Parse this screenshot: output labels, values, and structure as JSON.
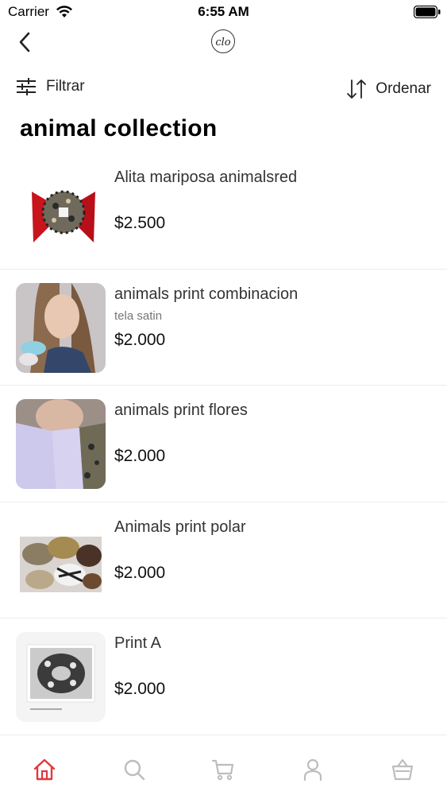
{
  "status_bar": {
    "carrier": "Carrier",
    "time": "6:55 AM"
  },
  "nav": {
    "logo_text": "clo"
  },
  "toolbar": {
    "filter_label": "Filtrar",
    "sort_label": "Ordenar"
  },
  "page_title": "animal collection",
  "products": [
    {
      "name": "Alita mariposa animalsred",
      "subtitle": "",
      "price": "$2.500"
    },
    {
      "name": "animals print combinacion",
      "subtitle": "tela satin",
      "price": "$2.000"
    },
    {
      "name": "animals print flores",
      "subtitle": "",
      "price": "$2.000"
    },
    {
      "name": "Animals print polar",
      "subtitle": "",
      "price": "$2.000"
    },
    {
      "name": "Print A",
      "subtitle": "",
      "price": "$2.000"
    }
  ],
  "tab_bar": {
    "tabs": [
      {
        "icon": "home-icon",
        "active": true
      },
      {
        "icon": "search-icon",
        "active": false
      },
      {
        "icon": "cart-icon",
        "active": false
      },
      {
        "icon": "user-icon",
        "active": false
      },
      {
        "icon": "bag-icon",
        "active": false
      }
    ]
  },
  "colors": {
    "accent": "#e0393e",
    "inactive_icon": "#bdbdbd",
    "divider": "#ececec"
  }
}
